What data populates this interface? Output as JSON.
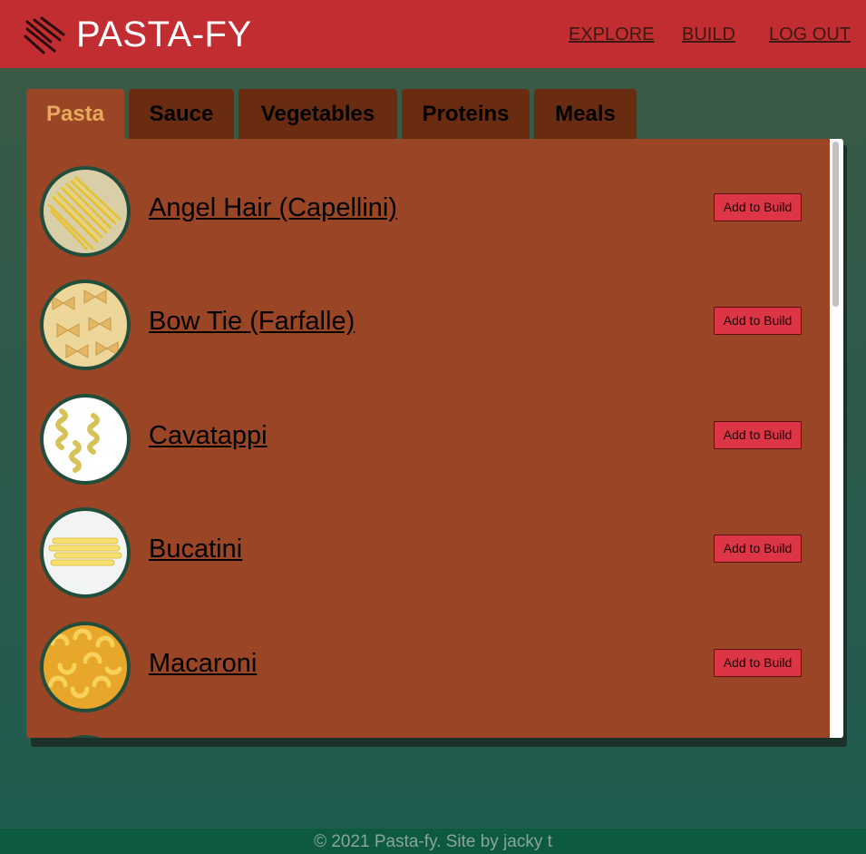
{
  "header": {
    "brand": "PASTA-FY",
    "logo_icon": "pasta-logo-icon",
    "nav": [
      {
        "label": "EXPLORE"
      },
      {
        "label": "BUILD"
      },
      {
        "label": "LOG OUT"
      }
    ]
  },
  "tabs": [
    {
      "label": "Pasta",
      "active": true
    },
    {
      "label": "Sauce",
      "active": false
    },
    {
      "label": "Vegetables",
      "active": false
    },
    {
      "label": "Proteins",
      "active": false
    },
    {
      "label": "Meals",
      "active": false
    }
  ],
  "items": [
    {
      "name": "Angel Hair (Capellini)",
      "button": "Add to Build",
      "image": "angel-hair-pasta-image"
    },
    {
      "name": "Bow Tie (Farfalle)",
      "button": "Add to Build",
      "image": "farfalle-pasta-image"
    },
    {
      "name": "Cavatappi",
      "button": "Add to Build",
      "image": "cavatappi-pasta-image"
    },
    {
      "name": "Bucatini",
      "button": "Add to Build",
      "image": "bucatini-pasta-image"
    },
    {
      "name": "Macaroni",
      "button": "Add to Build",
      "image": "macaroni-pasta-image"
    }
  ],
  "footer": {
    "text": "© 2021 Pasta-fy. Site by jacky t"
  },
  "colors": {
    "header": "#c22d31",
    "panel": "#9a4525",
    "tab_inactive": "#6a2c10",
    "tab_active_text": "#e7a95a",
    "button": "#dc3545",
    "footer": "#0d5a40"
  }
}
